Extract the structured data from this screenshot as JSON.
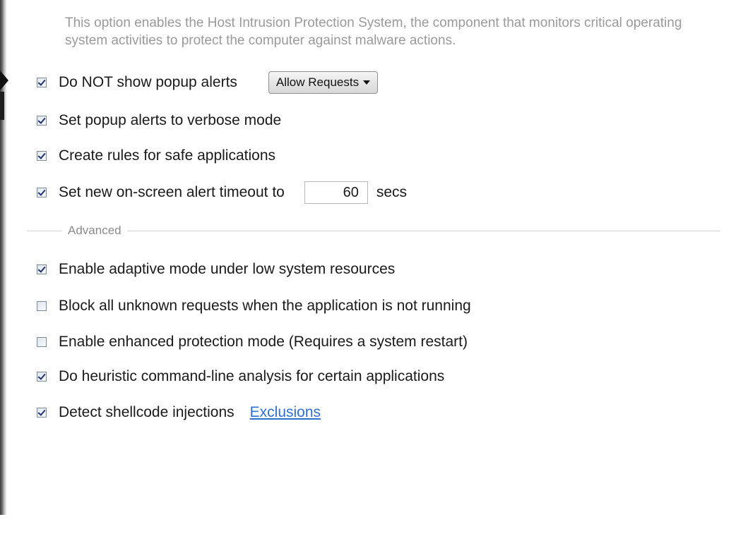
{
  "description": "This option enables the Host Intrusion Protection System, the component that monitors critical operating system activities to protect the computer against malware actions.",
  "options": {
    "no_popup": {
      "label": "Do NOT show popup alerts",
      "checked": true,
      "dropdown": "Allow Requests"
    },
    "verbose": {
      "label": "Set popup alerts to verbose mode",
      "checked": true
    },
    "safe_rules": {
      "label": "Create rules for safe applications",
      "checked": true
    },
    "timeout": {
      "label": "Set new on-screen alert timeout to",
      "checked": true,
      "value": "60",
      "unit": "secs"
    }
  },
  "advanced": {
    "title": "Advanced",
    "adaptive": {
      "label": "Enable adaptive mode under low system resources",
      "checked": true
    },
    "block_unknown": {
      "label": "Block all unknown requests when the application is not running",
      "checked": false
    },
    "enhanced": {
      "label": "Enable enhanced protection mode (Requires a system restart)",
      "checked": false
    },
    "heuristic": {
      "label": "Do heuristic command-line analysis for certain applications",
      "checked": true
    },
    "shellcode": {
      "label": "Detect shellcode injections",
      "checked": true,
      "link": "Exclusions"
    }
  },
  "colors": {
    "description_text": "#9a9a9a",
    "link": "#2f6fd0",
    "checkmark": "#21326b"
  }
}
